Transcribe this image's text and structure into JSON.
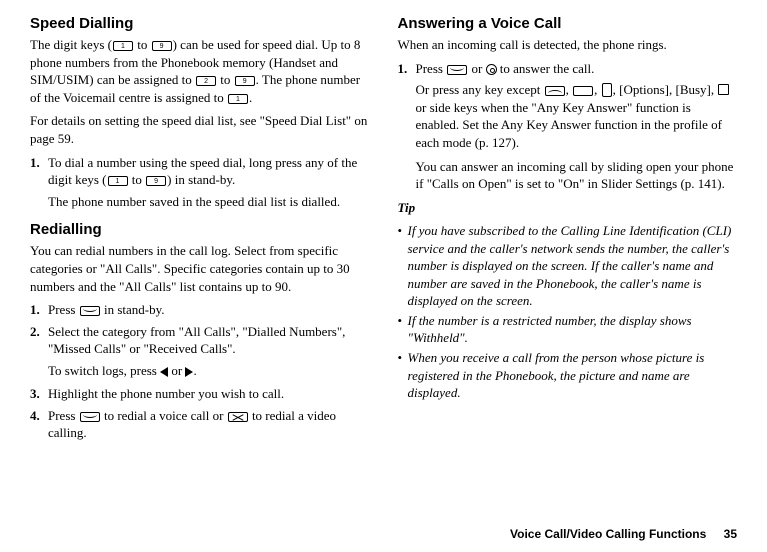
{
  "left": {
    "h_speed": "Speed Dialling",
    "speed_p1a": "The digit keys (",
    "speed_p1b": " to ",
    "speed_p1c": ") can be used for speed dial. Up to 8 phone numbers from the Phonebook memory (Handset and SIM/USIM) can be assigned to ",
    "speed_p1d": " to ",
    "speed_p1e": ". The phone number of the Voicemail centre is assigned to ",
    "speed_p1f": ".",
    "speed_p2": "For details on setting the speed dial list, see \"Speed Dial List\" on page 59.",
    "speed_s1n": "1.",
    "speed_s1a": "To dial a number using the speed dial, long press any of the digit keys (",
    "speed_s1b": " to ",
    "speed_s1c": ") in stand-by.",
    "speed_s1d": "The phone number saved in the speed dial list is dialled.",
    "h_redial": "Redialling",
    "redial_p1": "You can redial numbers in the call log. Select from specific categories or \"All Calls\". Specific categories contain up to 30 numbers and the \"All Calls\" list contains up to 90.",
    "rd1n": "1.",
    "rd1a": "Press ",
    "rd1b": " in stand-by.",
    "rd2n": "2.",
    "rd2": "Select the category from \"All Calls\", \"Dialled Numbers\", \"Missed Calls\" or \"Received Calls\".",
    "rd2sub_a": "To switch logs, press ",
    "rd2sub_b": " or ",
    "rd2sub_c": ".",
    "rd3n": "3.",
    "rd3": "Highlight the phone number you wish to call.",
    "rd4n": "4.",
    "rd4a": "Press ",
    "rd4b": " to redial a voice call or ",
    "rd4c": " to redial a video calling."
  },
  "right": {
    "h_ans": "Answering a Voice Call",
    "ans_p1": "When an incoming call is detected, the phone rings.",
    "ans1n": "1.",
    "ans1a": "Press ",
    "ans1b": " or ",
    "ans1c": " to answer the call.",
    "ans1d_a": "Or press any key except ",
    "ans1d_b": ", ",
    "ans1d_c": ", ",
    "ans1d_d": ", [Options], [Busy], ",
    "ans1d_e": " or side keys when the \"Any Key Answer\" function is enabled. Set the Any Key Answer function in the profile of each mode (p. 127).",
    "ans1e": "You can answer an incoming call by sliding open your phone if \"Calls on Open\" is set to \"On\" in Slider Settings (p. 141).",
    "tiphead": "Tip",
    "tip1": "If you have subscribed to the Calling Line Identification (CLI) service and the caller's network sends the number, the caller's number is displayed on the screen. If the caller's name and number are saved in the Phonebook, the caller's name is displayed on the screen.",
    "tip2": "If the number is a restricted number, the display shows \"Withheld\".",
    "tip3": "When you receive a call from the person whose picture is registered in the Phonebook, the picture and name are displayed."
  },
  "footer": {
    "title": "Voice Call/Video Calling Functions",
    "page": "35"
  },
  "keys": {
    "k1": "1",
    "k2": "2",
    "k9": "9"
  }
}
